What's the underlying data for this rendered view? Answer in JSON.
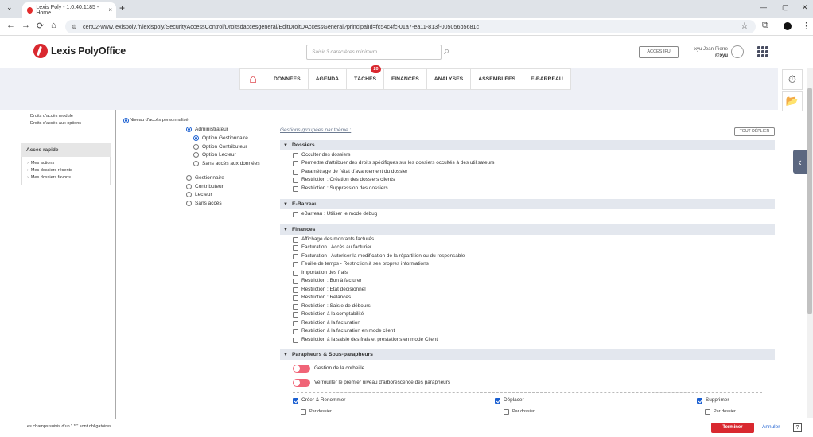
{
  "browser": {
    "tab_title": "Lexis Poly - 1.0.40.1185 - Home",
    "tab_close": "×",
    "new_tab": "+",
    "tab_menu": "⌄",
    "window_buttons": [
      "—",
      "▢",
      "✕"
    ],
    "url": "cert02-www.lexispoly.fr/lexispoly/SecurityAccessControl/Droitsdaccesgeneral/EditDroitDAccessGeneral?principalId=fc54c4fc-01a7-ea11-813f-005056b5681c",
    "nav": {
      "back": "←",
      "forward": "→",
      "reload": "⟳",
      "home": "⌂",
      "star": "☆",
      "ext": "⧉",
      "menu": "⋮"
    }
  },
  "header": {
    "logo_text": "Lexis PolyOffice",
    "search_placeholder": "Saisir 3 caractères minimum",
    "search_icon": "⌕",
    "acces_ifu": "ACCÈS IFU",
    "user_name": "xyu Jean-Pierre",
    "user_handle": "@xyu"
  },
  "nav": {
    "home_icon": "⌂",
    "items": [
      "DONNÉES",
      "AGENDA",
      "TÂCHES",
      "FINANCES",
      "ANALYSES",
      "ASSEMBLÉES",
      "E-BARREAU"
    ],
    "taches_badge": "20"
  },
  "right_tools": {
    "timer_icon": "⏱",
    "folder_icon": "📂",
    "collapse_icon": "‹"
  },
  "sidebar": {
    "links": [
      "Droits d'accès module",
      "Droits d'accès aux options"
    ],
    "quick_access_title": "Accès rapide",
    "quick_links": [
      "Mes actions",
      "Mes dossiers récents",
      "Mes dossiers favoris"
    ]
  },
  "access_level": {
    "custom_label": "Niveau d'accès personnalisé",
    "administrateur": "Administrateur",
    "admin_options": [
      "Option Gestionnaire",
      "Option Contributeur",
      "Option Lecteur",
      "Sans accès aux données"
    ],
    "others": [
      "Gestionnaire",
      "Contributeur",
      "Lecteur",
      "Sans accès"
    ]
  },
  "permissions": {
    "grouped_label": "Gestions groupées par thème :",
    "expand_all": "TOUT DÉPLIER",
    "dossiers_title": "Dossiers",
    "dossiers_items": [
      "Occulter des dossiers",
      "Permettre d'attribuer des droits spécifiques sur les dossiers occultés à des utilisateurs",
      "Paramétrage de l'état d'avancement du dossier",
      "Restriction : Création des dossiers clients",
      "Restriction : Suppression des dossiers"
    ],
    "ebarreau_title": "E-Barreau",
    "ebarreau_items": [
      "eBarreau : Utiliser le mode debug"
    ],
    "finances_title": "Finances",
    "finances_items": [
      "Affichage des montants facturés",
      "Facturation : Accès au facturier",
      "Facturation : Autoriser la modification de la répartition ou du responsable",
      "Feuille de temps - Restriction à ses propres informations",
      "Importation des frais",
      "Restriction : Bon à facturer",
      "Restriction : Etat décisionnel",
      "Restriction : Relances",
      "Restriction : Saisie de débours",
      "Restriction à la comptabilité",
      "Restriction à la facturation",
      "Restriction à la facturation en mode client",
      "Restriction à la saisie des frais et prestations en mode Client"
    ],
    "parapheurs_title": "Parapheurs & Sous-parapheurs",
    "parapheurs_toggles": [
      "Gestion de la corbeille",
      "Verrouiller le premier niveau d'arborescence des parapheurs"
    ],
    "parapheurs_cols": [
      "Créer & Renommer",
      "Déplacer",
      "Supprimer"
    ],
    "par_dossier": "Par dossier"
  },
  "footer": {
    "note": "Les champs suivis d'un \" * \" sont obligatoires.",
    "finish": "Terminer",
    "cancel": "Annuler",
    "help_icon": "?"
  },
  "colors": {
    "brand_red": "#d9282f",
    "accent_blue": "#1a5fd1",
    "nav_band": "#eef0f6"
  }
}
